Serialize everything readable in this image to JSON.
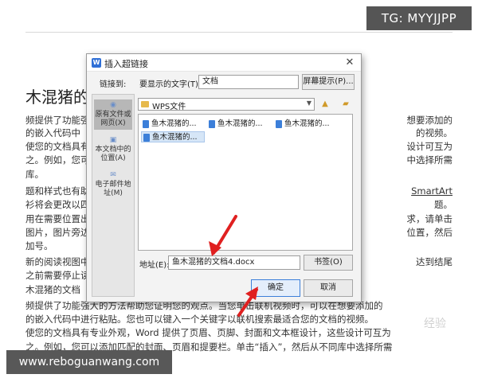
{
  "document": {
    "title": "木混猪的",
    "lines": [
      "频提供了功能强",
      "的嵌入代码中",
      "使您的文档具有",
      "之。例如，您可",
      "库。",
      "题和样式也有助",
      "衫将会更改以四",
      "用在需要位置出",
      "图片，图片旁边",
      "加号。",
      "新的阅读视图中",
      "之前需要停止读",
      "木混猪的文档",
      "频提供了功能强大的方法帮助您证明您的观点。当您单击联机视频时，可以在想要添加的",
      "的嵌入代码中进行粘贴。您也可以键入一个关键字以联机搜索最适合您的文档的视频。",
      "使您的文档具有专业外观，Word 提供了页眉、页脚、封面和文本框设计，这些设计可互为",
      "之。例如，您可以添加匹配的封面、页眉和提要栏。单击“插入”，然后从不同库中选择所需"
    ],
    "right_lines": [
      "想要添加的",
      "的视频。",
      "设计可互为",
      "中选择所需",
      "SmartArt",
      "题。",
      "求，请单击",
      "位置，然后",
      "达到结尾"
    ]
  },
  "overlays": {
    "tg_badge": "TG: MYYJJPP",
    "site_badge": "www.reboguanwang.com",
    "watermark": "经验"
  },
  "dialog": {
    "title": "插入超链接",
    "close": "✕",
    "link_to_label": "链接到:",
    "display_text_label": "要显示的文字(T):",
    "display_text_value": "文档",
    "screen_tip_button": "屏幕提示(P)...",
    "nav": [
      {
        "label": "原有文件或网页(X)"
      },
      {
        "label": "本文档中的位置(A)"
      },
      {
        "label": "电子邮件地址(M)"
      }
    ],
    "folder": "WPS文件",
    "files": [
      "鱼木混猪的...",
      "鱼木混猪的...",
      "鱼木混猪的...",
      "鱼木混猪的..."
    ],
    "address_label": "地址(E):",
    "address_value": "鱼木混猪的文档4.docx",
    "bookmark_button": "书签(O)",
    "ok_button": "确定",
    "cancel_button": "取消"
  },
  "colors": {
    "annotation_arrow": "#e02020",
    "primary_border": "#3c7fd9"
  }
}
